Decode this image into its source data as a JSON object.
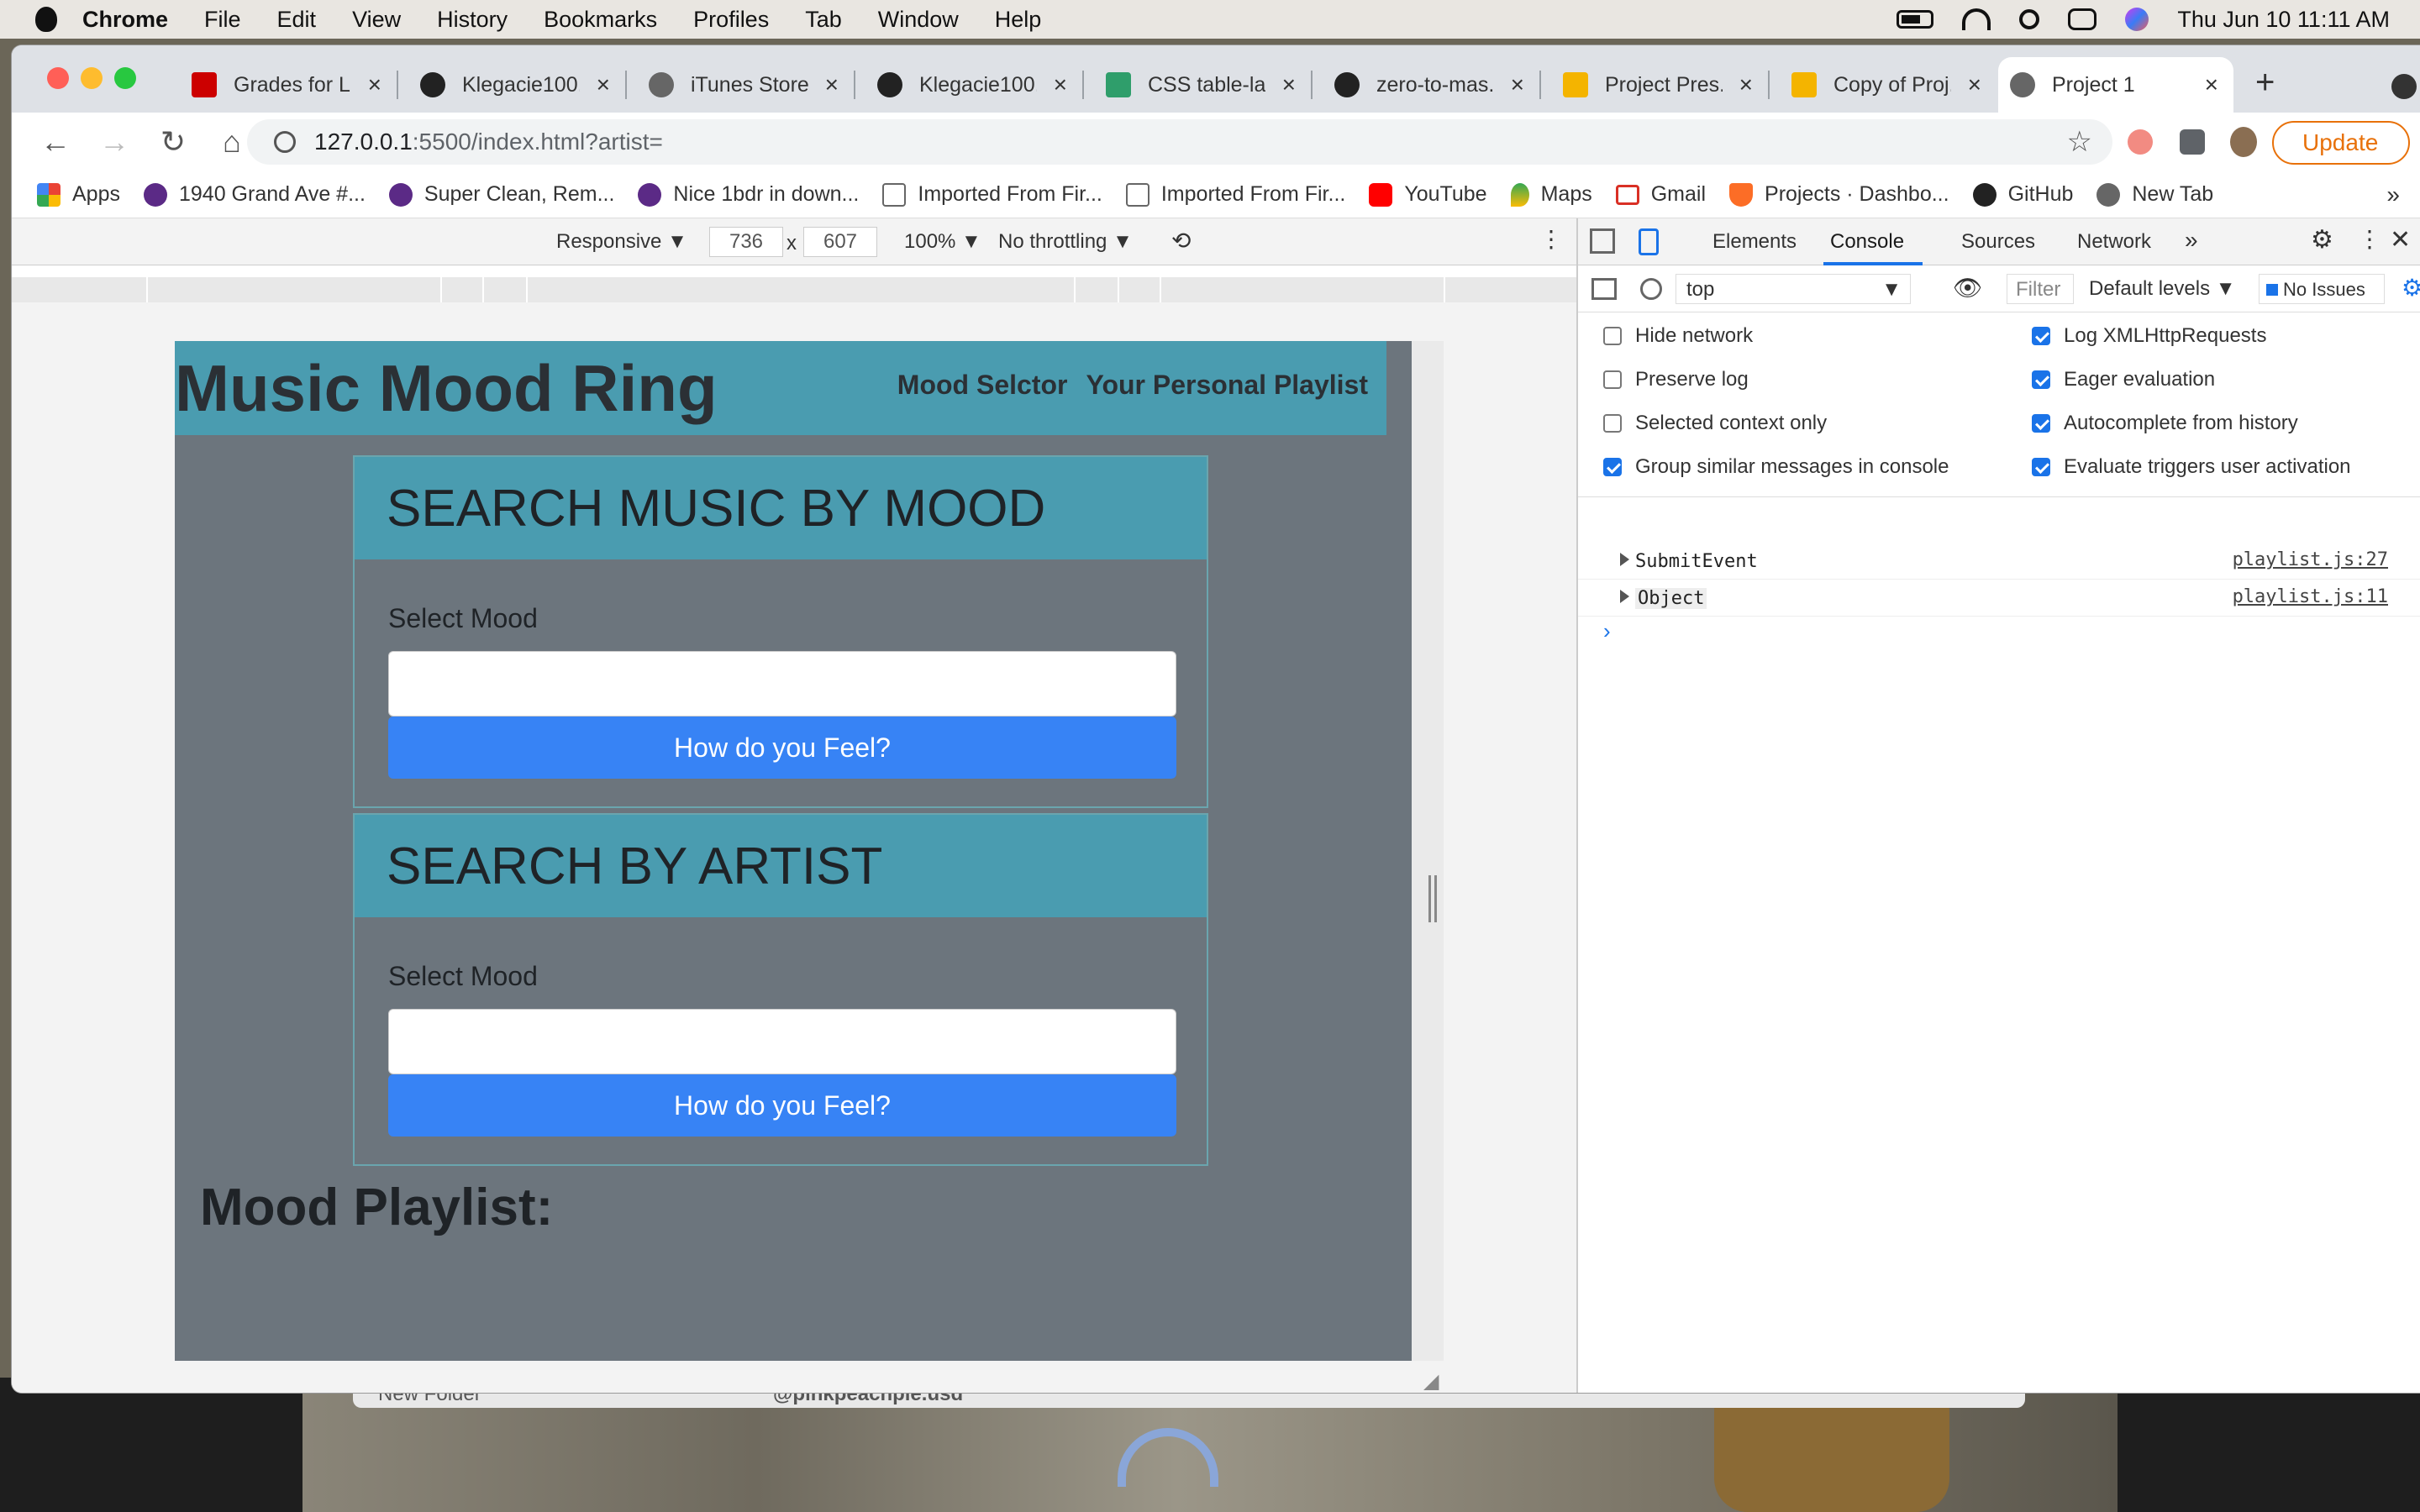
{
  "menubar": {
    "app": "Chrome",
    "items": [
      "File",
      "Edit",
      "View",
      "History",
      "Bookmarks",
      "Profiles",
      "Tab",
      "Window",
      "Help"
    ],
    "datetime": "Thu Jun 10  11:11 AM"
  },
  "tabs": [
    {
      "title": "Grades for L...",
      "icon": "u-logo-icon",
      "color": "#cc0000"
    },
    {
      "title": "Klegacie100...",
      "icon": "github-icon",
      "color": "#222222"
    },
    {
      "title": "iTunes Store",
      "icon": "globe-icon",
      "color": "#555555"
    },
    {
      "title": "Klegacie100...",
      "icon": "github-icon",
      "color": "#222222"
    },
    {
      "title": "CSS table-la...",
      "icon": "w-logo-icon",
      "color": "#2f9e6b"
    },
    {
      "title": "zero-to-mas...",
      "icon": "github-icon",
      "color": "#222222"
    },
    {
      "title": "Project Pres...",
      "icon": "slides-icon",
      "color": "#f4b400"
    },
    {
      "title": "Copy of Proj...",
      "icon": "slides-icon",
      "color": "#f4b400"
    },
    {
      "title": "Project 1",
      "icon": "globe-icon",
      "color": "#555555",
      "active": true
    }
  ],
  "address": {
    "host": "127.0.0.1",
    "path": ":5500/index.html?artist="
  },
  "update_label": "Update",
  "bookmarks": [
    {
      "label": "Apps",
      "icon": "apps-grid-icon"
    },
    {
      "label": "1940 Grand Ave #...",
      "icon": "peace-icon"
    },
    {
      "label": "Super Clean, Rem...",
      "icon": "peace-icon"
    },
    {
      "label": "Nice 1bdr in down...",
      "icon": "peace-icon"
    },
    {
      "label": "Imported From Fir...",
      "icon": "folder-icon"
    },
    {
      "label": "Imported From Fir...",
      "icon": "folder-icon"
    },
    {
      "label": "YouTube",
      "icon": "youtube-icon"
    },
    {
      "label": "Maps",
      "icon": "maps-icon"
    },
    {
      "label": "Gmail",
      "icon": "gmail-icon"
    },
    {
      "label": "Projects · Dashbo...",
      "icon": "gitlab-icon"
    },
    {
      "label": "GitHub",
      "icon": "github-icon"
    },
    {
      "label": "New Tab",
      "icon": "globe-icon"
    }
  ],
  "device_toolbar": {
    "mode": "Responsive ▼",
    "width": "736",
    "times": "x",
    "height": "607",
    "zoom": "100% ▼",
    "throttle": "No throttling ▼"
  },
  "site": {
    "title": "Music Mood Ring",
    "nav": [
      "Mood Selctor",
      "Your Personal Playlist"
    ],
    "cards": [
      {
        "heading": "SEARCH MUSIC BY MOOD",
        "label": "Select Mood",
        "button": "How do you Feel?"
      },
      {
        "heading": "SEARCH BY ARTIST",
        "label": "Select Mood",
        "button": "How do you Feel?"
      }
    ],
    "playlist_title": "Mood Playlist:"
  },
  "devtools": {
    "tabs": [
      "Elements",
      "Console",
      "Sources",
      "Network",
      "»"
    ],
    "active_tab": "Console",
    "context": "top",
    "filter_placeholder": "Filter",
    "levels": "Default levels ▼",
    "issues": "No Issues",
    "settings_left": [
      {
        "label": "Hide network",
        "checked": false
      },
      {
        "label": "Preserve log",
        "checked": false
      },
      {
        "label": "Selected context only",
        "checked": false
      },
      {
        "label": "Group similar messages in console",
        "checked": true
      }
    ],
    "settings_right": [
      {
        "label": "Log XMLHttpRequests",
        "checked": true
      },
      {
        "label": "Eager evaluation",
        "checked": true
      },
      {
        "label": "Autocomplete from history",
        "checked": true
      },
      {
        "label": "Evaluate triggers user activation",
        "checked": true
      }
    ],
    "logs": [
      {
        "message": "SubmitEvent",
        "source": "playlist.js:27"
      },
      {
        "message": "Object",
        "source": "playlist.js:11"
      }
    ],
    "prompt": "›"
  },
  "desktop": {
    "finder_item": "New Folder",
    "finder_title": "@pinkpeachpie.usd"
  }
}
